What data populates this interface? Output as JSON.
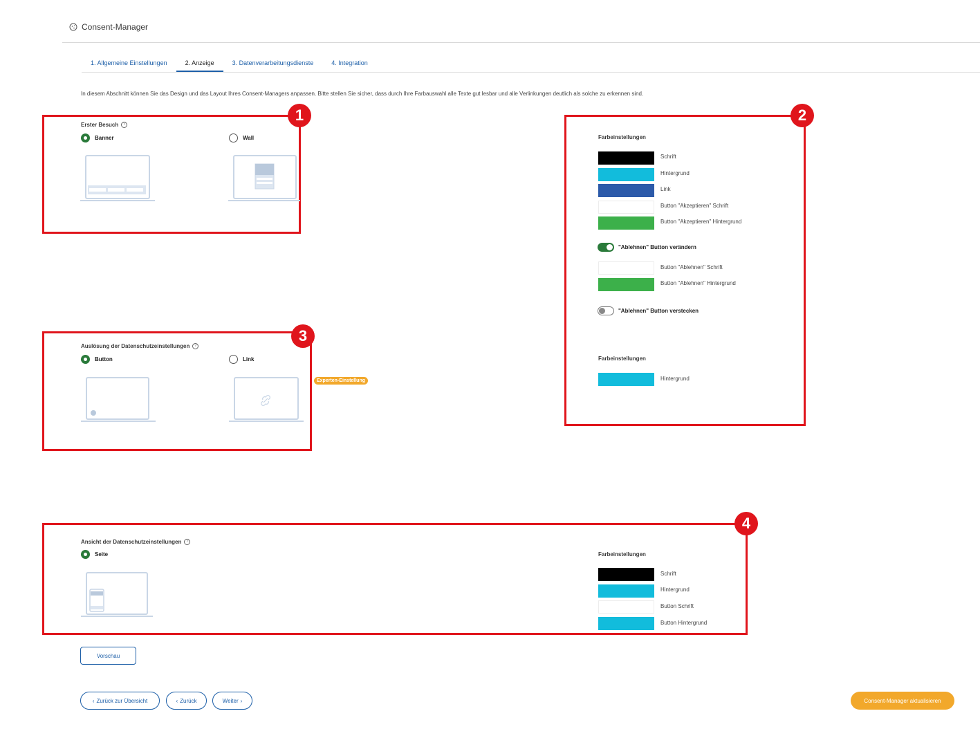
{
  "header": {
    "title": "Consent-Manager",
    "icon": "cookie-icon"
  },
  "tabs": [
    {
      "label": "1. Allgemeine Einstellungen",
      "active": false
    },
    {
      "label": "2. Anzeige",
      "active": true
    },
    {
      "label": "3. Datenverarbeitungsdienste",
      "active": false
    },
    {
      "label": "4. Integration",
      "active": false
    }
  ],
  "intro": "In diesem Abschnitt können Sie das Design und das Layout Ihres Consent-Managers anpassen. Bitte stellen Sie sicher, dass durch Ihre Farbauswahl alle Texte gut lesbar und alle Verlinkungen deutlich als solche zu erkennen sind.",
  "annotations": [
    "1",
    "2",
    "3",
    "4"
  ],
  "first_visit": {
    "label": "Erster Besuch",
    "options": [
      {
        "label": "Banner",
        "checked": true
      },
      {
        "label": "Wall",
        "checked": false
      }
    ]
  },
  "trigger": {
    "label": "Auslösung der Datenschutzeinstellungen",
    "options": [
      {
        "label": "Button",
        "checked": true
      },
      {
        "label": "Link",
        "checked": false
      }
    ],
    "expert_badge": "Experten-Einstellung"
  },
  "view": {
    "label": "Ansicht der Datenschutzeinstellungen",
    "options": [
      {
        "label": "Seite",
        "checked": true
      }
    ]
  },
  "colors": {
    "heading": "Farbeinstellungen",
    "main": [
      {
        "label": "Schrift",
        "color": "#000000"
      },
      {
        "label": "Hintergrund",
        "color": "#12bcdc"
      },
      {
        "label": "Link",
        "color": "#2c5aa9"
      },
      {
        "label": "Button \"Akzeptieren\" Schrift",
        "color": "#ffffff"
      },
      {
        "label": "Button \"Akzeptieren\" Hintergrund",
        "color": "#3cb04a"
      }
    ],
    "toggle_change_reject": {
      "label": "\"Ablehnen\" Button verändern",
      "on": true
    },
    "reject": [
      {
        "label": "Button \"Ablehnen\" Schrift",
        "color": "#ffffff"
      },
      {
        "label": "Button \"Ablehnen\" Hintergrund",
        "color": "#3cb04a"
      }
    ],
    "toggle_hide_reject": {
      "label": "\"Ablehnen\" Button verstecken",
      "on": false
    },
    "trigger_heading": "Farbeinstellungen",
    "trigger": [
      {
        "label": "Hintergrund",
        "color": "#12bcdc"
      }
    ],
    "view_heading": "Farbeinstellungen",
    "view": [
      {
        "label": "Schrift",
        "color": "#000000"
      },
      {
        "label": "Hintergrund",
        "color": "#12bcdc"
      },
      {
        "label": "Button Schrift",
        "color": "#ffffff"
      },
      {
        "label": "Button Hintergrund",
        "color": "#12bcdc"
      }
    ]
  },
  "buttons": {
    "preview": "Vorschau",
    "back_overview": "Zurück zur Übersicht",
    "back": "Zurück",
    "next": "Weiter",
    "update": "Consent-Manager aktualisieren"
  },
  "accent_colors": {
    "annotation": "#e0151c",
    "primary": "#f2a82b",
    "link": "#1d5fa8",
    "selected": "#2a7a3a"
  }
}
